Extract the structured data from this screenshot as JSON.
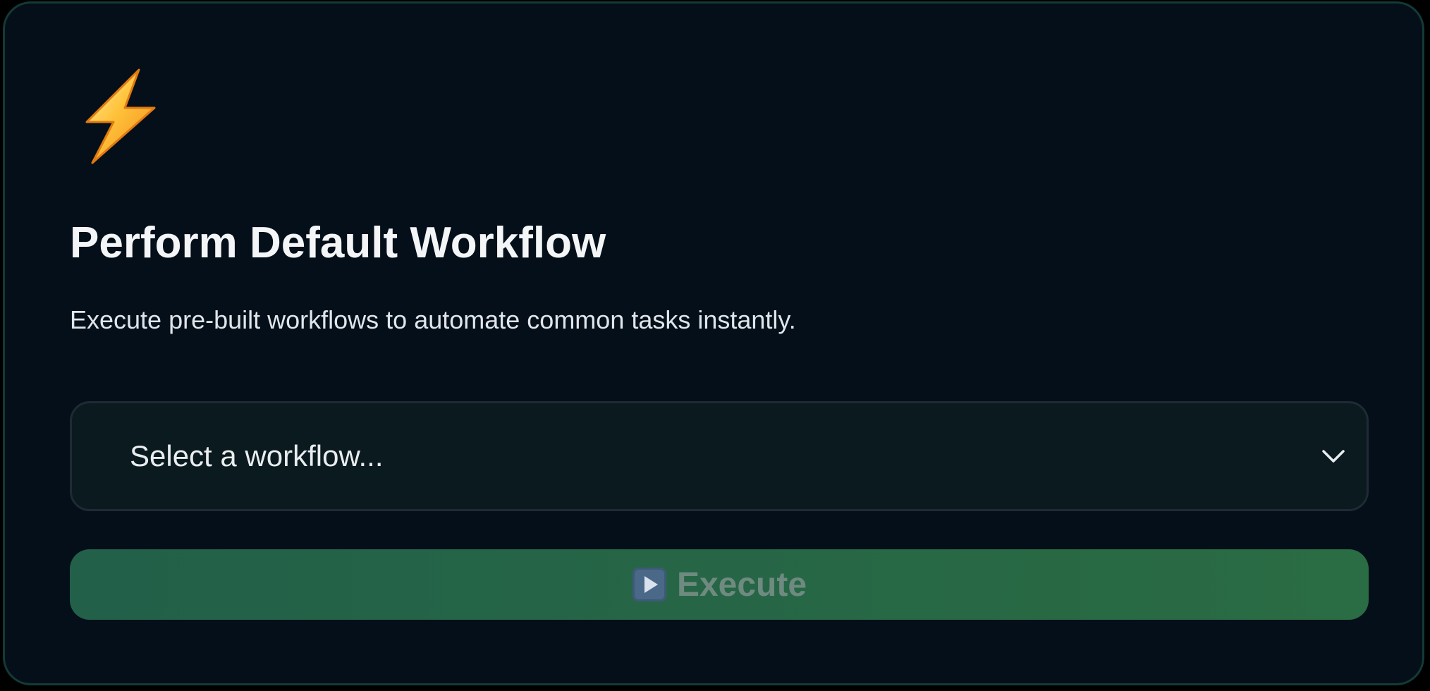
{
  "card": {
    "icon": "high-voltage-icon",
    "title": "Perform Default Workflow",
    "description": "Execute pre-built workflows to automate common tasks instantly."
  },
  "workflow_select": {
    "placeholder": "Select a workflow...",
    "icon": "chevron-down-icon"
  },
  "execute_button": {
    "icon": "play-button-icon",
    "label": "Execute",
    "disabled": true
  },
  "colors": {
    "background": "#050f19",
    "card_border": "#143a35",
    "select_background": "#0b1a1f",
    "button_gradient_start": "#226049",
    "button_gradient_end": "#2a6c43",
    "button_text": "#6f8a80"
  }
}
